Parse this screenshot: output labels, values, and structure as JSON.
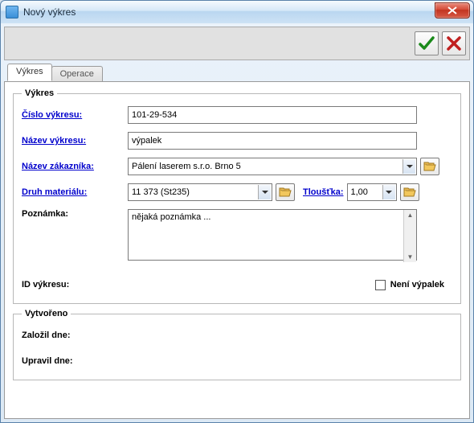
{
  "window": {
    "title": "Nový výkres"
  },
  "tabs": {
    "active": "Výkres",
    "inactive": "Operace"
  },
  "groups": {
    "drawing": {
      "legend": "Výkres",
      "fields": {
        "number_label": "Číslo výkresu:",
        "number_value": "101-29-534",
        "name_label": "Název výkresu:",
        "name_value": "výpalek",
        "customer_label": "Název zákazníka:",
        "customer_value": "Pálení laserem s.r.o. Brno 5",
        "material_label": "Druh materiálu:",
        "material_value": "11 373 (St235)",
        "thickness_label": "Tloušťka:",
        "thickness_value": "1,00",
        "note_label": "Poznámka:",
        "note_value": "nějaká poznámka ...",
        "id_label": "ID výkresu:",
        "id_value": "",
        "not_burnout_label": "Není výpalek"
      }
    },
    "created": {
      "legend": "Vytvořeno",
      "created_label": "Založil dne:",
      "created_value": "",
      "modified_label": "Upravil dne:",
      "modified_value": ""
    }
  }
}
